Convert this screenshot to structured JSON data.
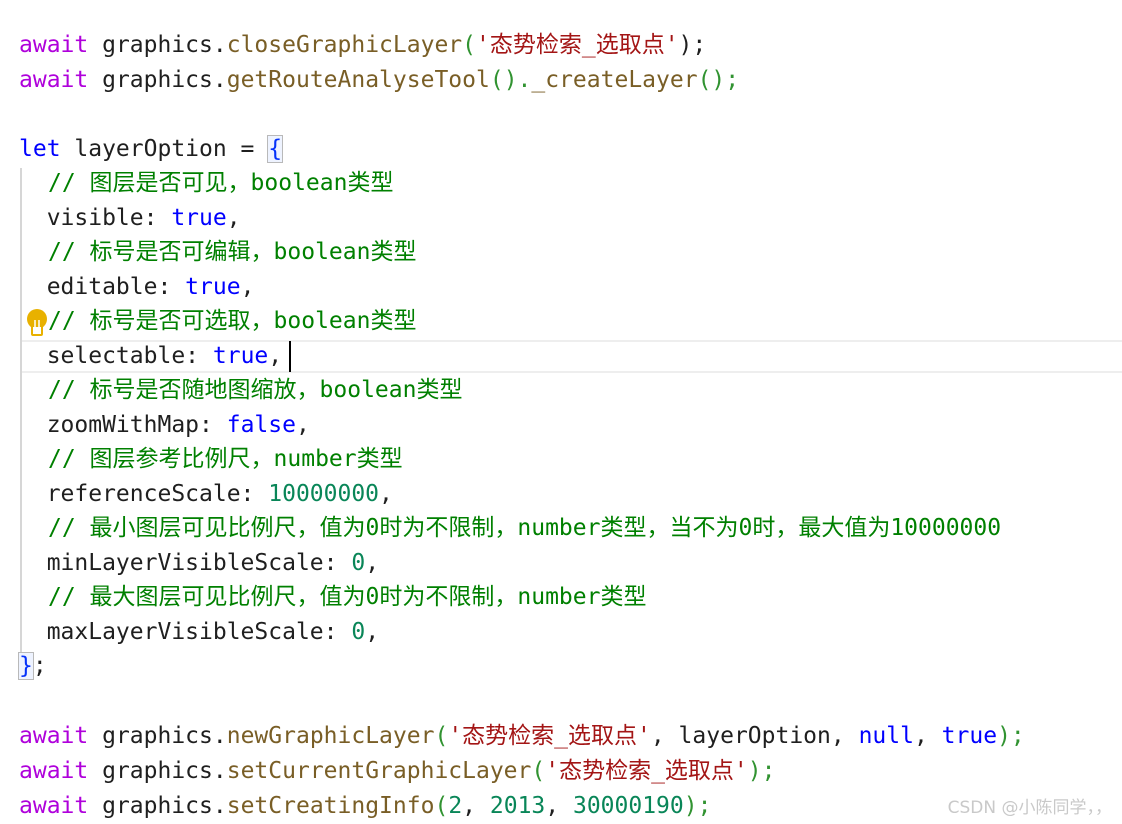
{
  "code": {
    "line1": {
      "t1": "await",
      "t2": " graphics.",
      "t3": "closeGraphicLayer",
      "t4": "(",
      "t5": "'态势检索_选取点'",
      "t6": ");"
    },
    "line2": {
      "t1": "await",
      "t2": " graphics.",
      "t3": "getRouteAnalyseTool",
      "t4": "().",
      "t5": "_createLayer",
      "t6": "();"
    },
    "line3": {
      "t1": "let",
      "t2": " layerOption = ",
      "t3": "{"
    },
    "c_visible": "// 图层是否可见，boolean类型",
    "visible": {
      "key": "  visible: ",
      "val": "true",
      ",": ","
    },
    "c_editable": "// 标号是否可编辑，boolean类型",
    "editable": {
      "key": "  editable: ",
      "val": "true",
      ",": ","
    },
    "c_selectable": "// 标号是否可选取，boolean类型",
    "selectable": {
      "key": "  selectable: ",
      "val": "true",
      ",": ","
    },
    "c_zoom": "// 标号是否随地图缩放，boolean类型",
    "zoom": {
      "key": "  zoomWithMap: ",
      "val": "false",
      ",": ","
    },
    "c_ref": "// 图层参考比例尺，number类型",
    "ref": {
      "key": "  referenceScale: ",
      "val": "10000000",
      ",": ","
    },
    "c_min": "// 最小图层可见比例尺，值为0时为不限制，number类型，当不为0时，最大值为10000000",
    "min": {
      "key": "  minLayerVisibleScale: ",
      "val": "0",
      ",": ","
    },
    "c_max": "// 最大图层可见比例尺，值为0时为不限制，number类型",
    "max": {
      "key": "  maxLayerVisibleScale: ",
      "val": "0",
      ",": ","
    },
    "close": {
      "b": "}",
      "s": ";"
    },
    "line_new": {
      "t1": "await",
      "t2": " graphics.",
      "t3": "newGraphicLayer",
      "t4": "(",
      "t5": "'态势检索_选取点'",
      "t6": ", layerOption, ",
      "t7": "null",
      ",": ", ",
      "t8": "true",
      "t9": ");"
    },
    "line_set": {
      "t1": "await",
      "t2": " graphics.",
      "t3": "setCurrentGraphicLayer",
      "t4": "(",
      "t5": "'态势检索_选取点'",
      "t6": ");"
    },
    "line_info": {
      "t1": "await",
      "t2": " graphics.",
      "t3": "setCreatingInfo",
      "t4": "(",
      "n1": "2",
      "s1": ", ",
      "n2": "2013",
      "s2": ", ",
      "n3": "30000190",
      "t6": ");"
    }
  },
  "watermark": "CSDN @小陈同学，，",
  "icons": {
    "lightbulb": "lightbulb-icon"
  },
  "colors": {
    "keyword": "#af00db",
    "keyword_blue": "#0000ff",
    "function": "#795e26",
    "string": "#a31515",
    "number": "#098658",
    "comment": "#008000"
  }
}
